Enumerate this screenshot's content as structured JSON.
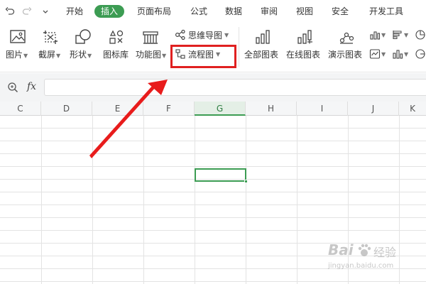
{
  "menubar": {
    "tabs": [
      "开始",
      "插入",
      "页面布局",
      "公式",
      "数据",
      "审阅",
      "视图",
      "安全",
      "开发工具"
    ],
    "active_tab": "插入"
  },
  "ribbon": {
    "picture": "图片",
    "screenshot": "截屏",
    "shape": "形状",
    "icon_library": "图标库",
    "function_chart": "功能图",
    "mind_map": "思维导图",
    "flowchart": "流程图",
    "all_charts": "全部图表",
    "online_charts": "在线图表",
    "demo_charts": "演示图表"
  },
  "formula_bar": {
    "fx_label": "fx",
    "value": ""
  },
  "columns": [
    "C",
    "D",
    "E",
    "F",
    "G",
    "H",
    "I",
    "J",
    "K"
  ],
  "selected_column": "G",
  "watermark": {
    "brand": "Bai",
    "brand_suffix": "经验",
    "url": "jingyan.baidu.com"
  },
  "colors": {
    "accent": "#3c9c53",
    "highlight": "#e02020"
  }
}
